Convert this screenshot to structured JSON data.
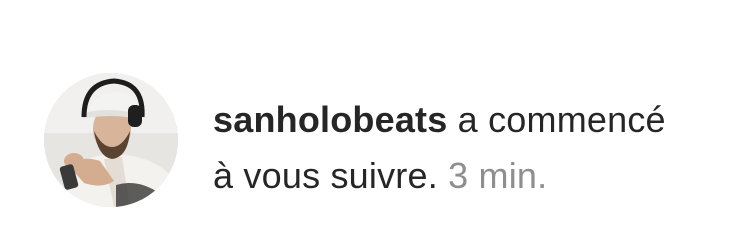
{
  "notification": {
    "username": "sanholobeats",
    "action_line1": "a commencé",
    "action_line2": "à vous suivre.",
    "time": "3 min."
  },
  "avatar": {
    "icon": "profile-photo"
  },
  "colors": {
    "text": "#262626",
    "muted": "#8e8e8e",
    "background": "#ffffff"
  }
}
